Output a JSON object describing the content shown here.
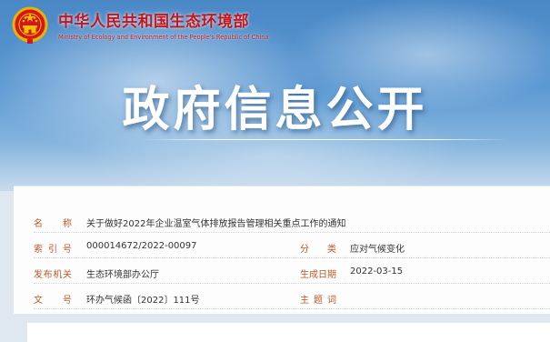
{
  "header": {
    "ministry_cn": "中华人民共和国生态环境部",
    "ministry_en": "Ministry of Ecology and Environment of the People's Republic of China",
    "emblem_icon": "national-emblem-icon",
    "page_title": "政府信息公开"
  },
  "colors": {
    "ministry_red": "#c4161c",
    "label_orange": "#b85a2a",
    "sky_blue": "#4a88c6"
  },
  "meta": {
    "name_label": [
      "名",
      "称"
    ],
    "name_value": "关于做好2022年企业温室气体排放报告管理相关重点工作的通知",
    "index_label": [
      "索",
      "引",
      "号"
    ],
    "index_value": "000014672/2022-00097",
    "category_label": [
      "分",
      "类"
    ],
    "category_value": "应对气候变化",
    "issuer_label": [
      "发",
      "布",
      "机",
      "关"
    ],
    "issuer_value": "生态环境部办公厅",
    "date_label": [
      "生",
      "成",
      "日",
      "期"
    ],
    "date_value": "2022-03-15",
    "docno_label": [
      "文",
      "号"
    ],
    "docno_value": "环办气候函〔2022〕111号",
    "subject_label": [
      "主",
      "题",
      "词"
    ],
    "subject_value": ""
  }
}
